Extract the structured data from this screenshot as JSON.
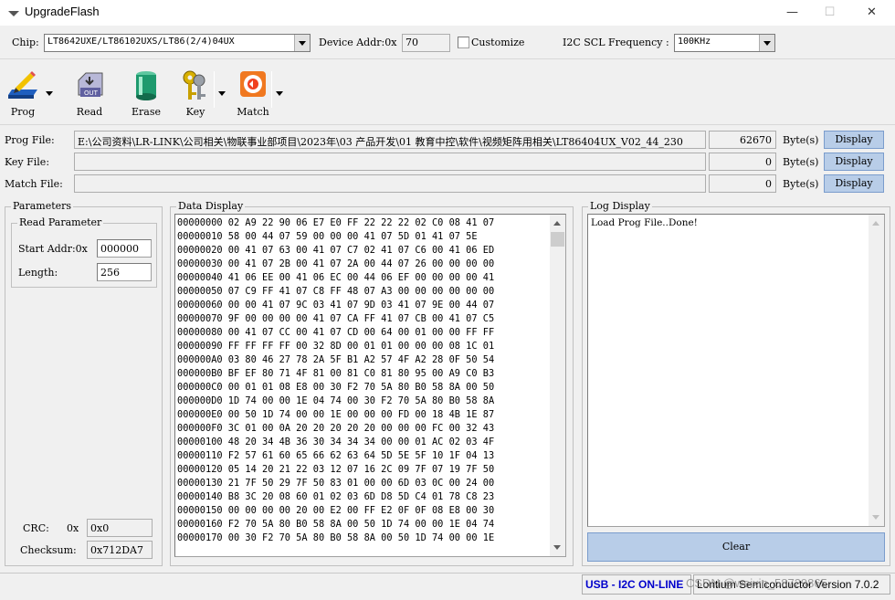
{
  "window": {
    "title": "UpgradeFlash",
    "minimize": "—",
    "maximize": "☐",
    "close": "✕"
  },
  "toolbar_top": {
    "chip_label": "Chip:",
    "chip_value": "LT8642UXE/LT86102UXS/LT86(2/4)04UX",
    "device_addr_label": "Device Addr:0x",
    "device_addr_value": "70",
    "customize_label": "Customize",
    "i2c_label": "I2C SCL Frequency :",
    "i2c_value": "100KHz"
  },
  "tools": [
    {
      "label": "Prog",
      "icon": "pencil-write-icon"
    },
    {
      "label": "Read",
      "icon": "read-out-icon"
    },
    {
      "label": "Erase",
      "icon": "erase-cylinder-icon"
    },
    {
      "label": "Key",
      "icon": "keys-icon"
    },
    {
      "label": "Match",
      "icon": "match-orange-icon"
    }
  ],
  "files": {
    "prog_label": "Prog File:",
    "prog_path": "E:\\公司资料\\LR-LINK\\公司相关\\物联事业部项目\\2023年\\03 产品开发\\01 教育中控\\软件\\视频矩阵用相关\\LT86404UX_V02_44_230",
    "prog_bytes": "62670",
    "key_label": "Key  File:",
    "key_path": "",
    "key_bytes": "0",
    "match_label": "Match File:",
    "match_path": "",
    "match_bytes": "0",
    "bytes_unit": "Byte(s)",
    "display_label": "Display"
  },
  "parameters": {
    "title": "Parameters",
    "read_title": "Read Parameter",
    "start_label": "Start Addr:0x",
    "start_value": "000000",
    "length_label": "Length:",
    "length_value": "256",
    "crc_label": "CRC:",
    "crc_prefix": "0x",
    "crc_value": "0x0",
    "checksum_label": "Checksum:",
    "checksum_value": "0x712DA7"
  },
  "data_display": {
    "title": "Data Display",
    "rows": [
      "00000000 02 A9 22 90 06 E7 E0 FF 22 22 22 02 C0 08 41 07",
      "00000010 58 00 44 07 59 00 00 00 41 07 5D 01 41 07 5E",
      "00000020 00 41 07 63 00 41 07 C7 02 41 07 C6 00 41 06 ED",
      "00000030 00 41 07 2B 00 41 07 2A 00 44 07 26 00 00 00 00",
      "00000040 41 06 EE 00 41 06 EC 00 44 06 EF 00 00 00 00 41",
      "00000050 07 C9 FF 41 07 C8 FF 48 07 A3 00 00 00 00 00 00",
      "00000060 00 00 41 07 9C 03 41 07 9D 03 41 07 9E 00 44 07",
      "00000070 9F 00 00 00 00 41 07 CA FF 41 07 CB 00 41 07 C5",
      "00000080 00 41 07 CC 00 41 07 CD 00 64 00 01 00 00 FF FF",
      "00000090 FF FF FF FF 00 32 8D 00 01 01 00 00 00 08 1C 01",
      "000000A0 03 80 46 27 78 2A 5F B1 A2 57 4F A2 28 0F 50 54",
      "000000B0 BF EF 80 71 4F 81 00 81 C0 81 80 95 00 A9 C0 B3",
      "000000C0 00 01 01 08 E8 00 30 F2 70 5A 80 B0 58 8A 00 50",
      "000000D0 1D 74 00 00 1E 04 74 00 30 F2 70 5A 80 B0 58 8A",
      "000000E0 00 50 1D 74 00 00 1E 00 00 00 FD 00 18 4B 1E 87",
      "000000F0 3C 01 00 0A 20 20 20 20 20 00 00 00 FC 00 32 43",
      "00000100 48 20 34 4B 36 30 34 34 34 00 00 01 AC 02 03 4F",
      "00000110 F2 57 61 60 65 66 62 63 64 5D 5E 5F 10 1F 04 13",
      "00000120 05 14 20 21 22 03 12 07 16 2C 09 7F 07 19 7F 50",
      "00000130 21 7F 50 29 7F 50 83 01 00 00 6D 03 0C 00 24 00",
      "00000140 B8 3C 20 08 60 01 02 03 6D D8 5D C4 01 78 C8 23",
      "00000150 00 00 00 00 20 00 E2 00 FF E2 0F 0F 08 E8 00 30",
      "00000160 F2 70 5A 80 B0 58 8A 00 50 1D 74 00 00 1E 04 74",
      "00000170 00 30 F2 70 5A 80 B0 58 8A 00 50 1D 74 00 00 1E"
    ]
  },
  "log_display": {
    "title": "Log Display",
    "text": "Load Prog File..Done!",
    "clear_label": "Clear"
  },
  "status": {
    "usb_text": "USB - I2C ON-LINE",
    "company_text": "Lontium Semiconductor  Version 7.0.2",
    "watermark": "CSDN @weixin_58729865"
  },
  "colors": {
    "display_button": "#b8cde8",
    "status_blue": "#0000cc",
    "clear_button": "#b8cde8"
  }
}
